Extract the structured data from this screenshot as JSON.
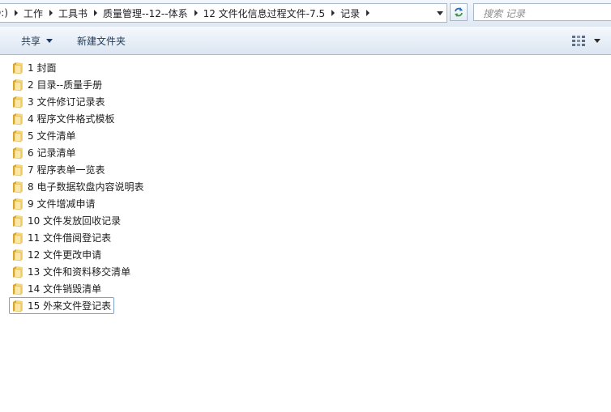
{
  "address_bar": {
    "crumbs": [
      "D:)",
      "工作",
      "工具书",
      "质量管理--12--体系",
      "12 文件化信息过程文件-7.5",
      "记录"
    ]
  },
  "search": {
    "placeholder": "搜索 记录"
  },
  "toolbar": {
    "share_label": "共享",
    "new_folder_label": "新建文件夹"
  },
  "folders": [
    "1 封面",
    "2 目录--质量手册",
    "3 文件修订记录表",
    "4 程序文件格式模板",
    "5 文件清单",
    "6 记录清单",
    "7 程序表单一览表",
    "8 电子数据软盘内容说明表",
    "9 文件增减申请",
    "10 文件发放回收记录",
    "11 文件借阅登记表",
    "12 文件更改申请",
    "13 文件和资料移交清单",
    "14 文件销毁清单",
    "15 外来文件登记表"
  ],
  "selected_index": 14,
  "colors": {
    "folder_light": "#f7d777",
    "folder_dark": "#d9a72e",
    "selection_border": "#7da2ce",
    "toolbar_text": "#1e395b"
  }
}
